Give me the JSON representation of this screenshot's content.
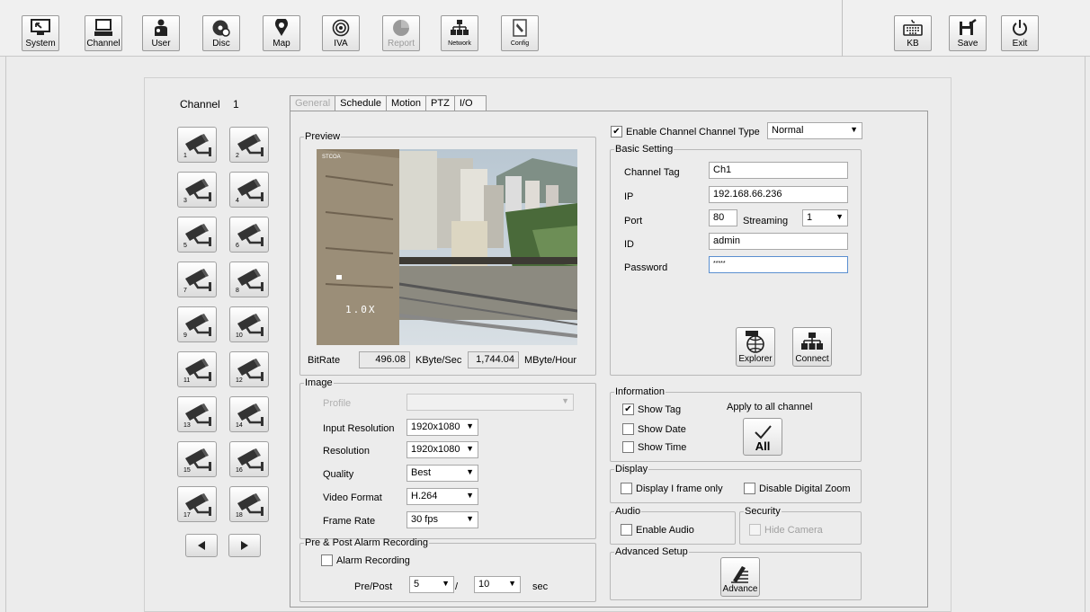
{
  "toolbar": {
    "system": "System",
    "channel": "Channel",
    "user": "User",
    "disc": "Disc",
    "map": "Map",
    "iva": "IVA",
    "report": "Report",
    "network": "Network",
    "config": "Config",
    "kb": "KB",
    "save": "Save",
    "exit": "Exit"
  },
  "channel_panel": {
    "label": "Channel",
    "current": "1",
    "cameras": [
      "1",
      "2",
      "3",
      "4",
      "5",
      "6",
      "7",
      "8",
      "9",
      "10",
      "11",
      "12",
      "13",
      "14",
      "15",
      "16",
      "17",
      "18"
    ]
  },
  "tabs": [
    "General",
    "Schedule",
    "Motion",
    "PTZ",
    "I/O"
  ],
  "preview": {
    "legend": "Preview",
    "overlay_tag": "STCOA",
    "overlay_zoom": "1.0X",
    "bitrate_label": "BitRate",
    "bitrate_value": "496.08",
    "bitrate_unit": "KByte/Sec",
    "hour_value": "1,744.04",
    "hour_unit": "MByte/Hour"
  },
  "image": {
    "legend": "Image",
    "profile_label": "Profile",
    "profile_value": "",
    "input_resolution_label": "Input Resolution",
    "input_resolution_value": "1920x1080",
    "resolution_label": "Resolution",
    "resolution_value": "1920x1080",
    "quality_label": "Quality",
    "quality_value": "Best",
    "video_format_label": "Video Format",
    "video_format_value": "H.264",
    "frame_rate_label": "Frame Rate",
    "frame_rate_value": "30 fps"
  },
  "alarm": {
    "legend": "Pre & Post Alarm Recording",
    "alarm_recording_label": "Alarm Recording",
    "alarm_recording_checked": false,
    "prepost_label": "Pre/Post",
    "pre_value": "5",
    "separator": "/",
    "post_value": "10",
    "unit": "sec"
  },
  "enable": {
    "enable_channel_label": "Enable Channel",
    "enable_channel_checked": true,
    "channel_type_label": "Channel Type",
    "channel_type_value": "Normal"
  },
  "basic": {
    "legend": "Basic Setting",
    "tag_label": "Channel Tag",
    "tag_value": "Ch1",
    "ip_label": "IP",
    "ip_value": "192.168.66.236",
    "port_label": "Port",
    "port_value": "80",
    "streaming_label": "Streaming",
    "streaming_value": "1",
    "id_label": "ID",
    "id_value": "admin",
    "password_label": "Password",
    "password_value": "*****",
    "explorer_label": "Explorer",
    "connect_label": "Connect"
  },
  "information": {
    "legend": "Information",
    "show_tag": "Show Tag",
    "show_tag_checked": true,
    "show_date": "Show Date",
    "show_time": "Show Time",
    "apply_all_label": "Apply to all channel",
    "all_button": "All"
  },
  "display": {
    "legend": "Display",
    "iframe_label": "Display I frame only",
    "digital_zoom_label": "Disable Digital Zoom"
  },
  "audio": {
    "legend": "Audio",
    "enable_audio": "Enable Audio"
  },
  "security": {
    "legend": "Security",
    "hide_camera": "Hide Camera"
  },
  "advanced": {
    "legend": "Advanced Setup",
    "advance_button": "Advance"
  }
}
